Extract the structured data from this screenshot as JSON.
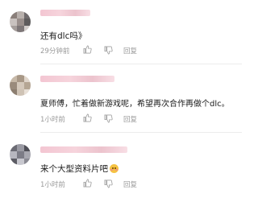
{
  "comments": [
    {
      "text": "还有dlc吗》",
      "time": "29分钟前",
      "reply_label": "回复",
      "avatar_colors": [
        "#8a7f7a",
        "#b8b0ac",
        "#6f6a6c",
        "#c9c2bf",
        "#9a8f8c",
        "#5e5b5c",
        "#a59d9a",
        "#7e7778",
        "#d2ccca"
      ]
    },
    {
      "text": "夏师傅，忙着做新游戏呢，希望再次合作再做个dlc。",
      "time": "1小时前",
      "reply_label": "回复",
      "avatar_colors": [
        "#c7b9a8",
        "#a89887",
        "#e0d6cb",
        "#9a8b7c",
        "#d4c8bb",
        "#b5a694",
        "#8c7e70",
        "#cfc3b5",
        "#e8e0d7"
      ]
    },
    {
      "text": "来个大型资料片吧",
      "time": "1小时前",
      "reply_label": "回复",
      "avatar_colors": [
        "#6b6b74",
        "#9a9aa3",
        "#4f4f57",
        "#b7b7bf",
        "#7c7c86",
        "#a8a8b0",
        "#5c5c64",
        "#c8c8cf",
        "#8a8a93"
      ]
    }
  ],
  "icons": {
    "like": "thumbs-up-icon",
    "dislike": "thumbs-down-icon",
    "emoji": "blush-emoji-icon"
  }
}
